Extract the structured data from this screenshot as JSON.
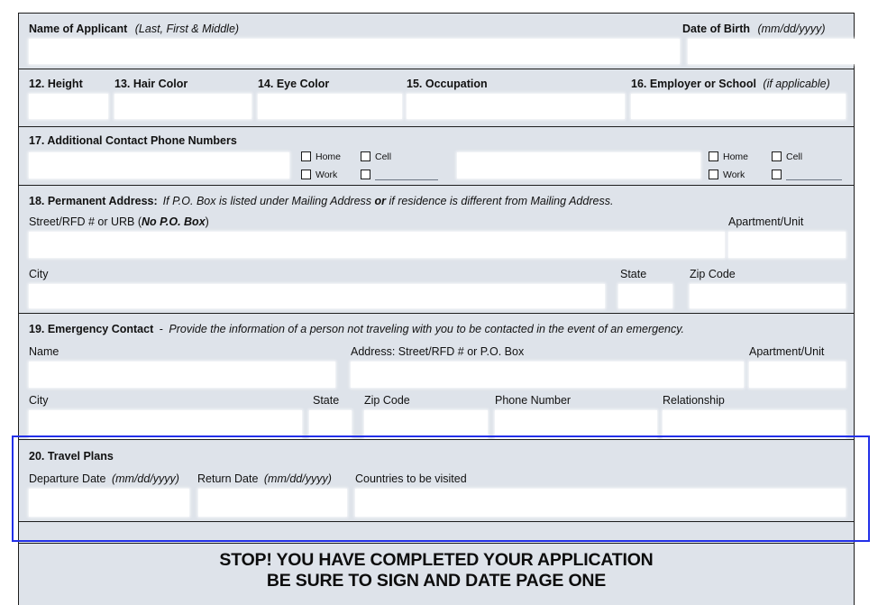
{
  "form": {
    "section_name": {
      "applicant_label": "Name of Applicant",
      "applicant_hint": "(Last, First & Middle)",
      "dob_label": "Date of Birth",
      "dob_hint": "(mm/dd/yyyy)"
    },
    "section_physical": {
      "height_label": "12. Height",
      "hair_label": "13. Hair Color",
      "eye_label": "14. Eye Color",
      "occupation_label": "15. Occupation",
      "employer_label": "16. Employer or School",
      "employer_hint": "(if applicable)"
    },
    "section_phones": {
      "heading": "17. Additional Contact Phone Numbers",
      "group1": {
        "home_label": "Home",
        "cell_label": "Cell",
        "work_label": "Work",
        "other_label": ""
      },
      "group2": {
        "home_label": "Home",
        "cell_label": "Cell",
        "work_label": "Work",
        "other_label": ""
      }
    },
    "section_permanent_address": {
      "heading_bold": "18. Permanent Address:",
      "heading_italic_a": "If P.O. Box is listed under Mailing Address ",
      "heading_italic_or": "or",
      "heading_italic_b": " if residence is different from Mailing Address.",
      "street_label_a": "Street/RFD # or URB (",
      "street_label_nopobox": "No P.O. Box",
      "street_label_b": ")",
      "apartment_label": "Apartment/Unit",
      "city_label": "City",
      "state_label": "State",
      "zip_label": "Zip Code"
    },
    "section_emergency": {
      "heading_bold": "19. Emergency Contact",
      "heading_dash": "-",
      "heading_italic": "Provide the information of a person not traveling with you to be contacted in the event of an emergency.",
      "name_label": "Name",
      "address_label": "Address: Street/RFD # or P.O. Box",
      "apartment_label": "Apartment/Unit",
      "city_label": "City",
      "state_label": "State",
      "zip_label": "Zip Code",
      "phone_label": "Phone Number",
      "relationship_label": "Relationship"
    },
    "section_travel": {
      "heading": "20. Travel Plans",
      "departure_label": "Departure Date",
      "departure_hint": "(mm/dd/yyyy)",
      "return_label": "Return Date",
      "return_hint": "(mm/dd/yyyy)",
      "countries_label": "Countries to be visited"
    },
    "stop_banner": {
      "line1": "STOP! YOU HAVE COMPLETED YOUR APPLICATION",
      "line2": "BE SURE TO SIGN AND DATE PAGE ONE"
    },
    "values": {
      "applicant_name": "",
      "dob": "",
      "height": "",
      "hair_color": "",
      "eye_color": "",
      "occupation": "",
      "employer": "",
      "phone1": "",
      "phone2": "",
      "perm_street": "",
      "perm_apartment": "",
      "perm_city": "",
      "perm_state": "",
      "perm_zip": "",
      "emg_name": "",
      "emg_address": "",
      "emg_apartment": "",
      "emg_city": "",
      "emg_state": "",
      "emg_zip": "",
      "emg_phone": "",
      "emg_relationship": "",
      "departure_date": "",
      "return_date": "",
      "countries": ""
    },
    "colors": {
      "panel_background": "#dee3ea",
      "panel_border": "#1d1d1d",
      "field_background": "#ffffff",
      "highlight_border": "#2330e8",
      "text": "#111111"
    }
  }
}
